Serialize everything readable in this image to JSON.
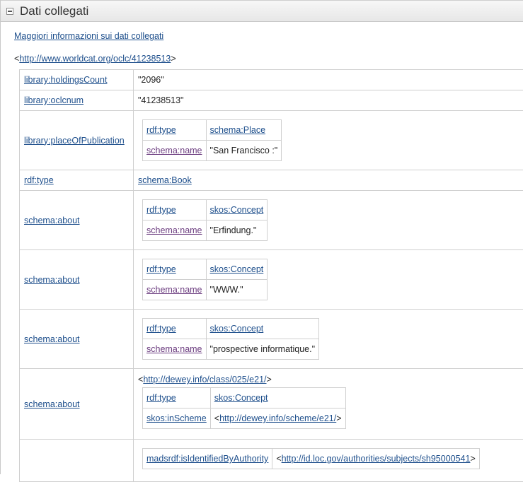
{
  "panel": {
    "title": "Dati collegati"
  },
  "more_link": "Maggiori informazioni sui dati collegati",
  "subject": {
    "open": "<",
    "uri": "http://www.worldcat.org/oclc/41238513",
    "close": ">"
  },
  "rows": [
    {
      "key": "library:holdingsCount",
      "value": "\"2096\""
    },
    {
      "key": "library:oclcnum",
      "value": "\"41238513\""
    },
    {
      "key": "library:placeOfPublication",
      "nested": [
        [
          "rdf:type",
          "schema:Place"
        ],
        [
          "schema:name",
          "\"San Francisco :\""
        ]
      ]
    },
    {
      "key": "rdf:type",
      "value": "schema:Book"
    },
    {
      "key": "schema:about",
      "nested": [
        [
          "rdf:type",
          "skos:Concept"
        ],
        [
          "schema:name",
          "\"Erfindung.\""
        ]
      ]
    },
    {
      "key": "schema:about",
      "nested": [
        [
          "rdf:type",
          "skos:Concept"
        ],
        [
          "schema:name",
          "\"WWW.\""
        ]
      ]
    },
    {
      "key": "schema:about",
      "nested": [
        [
          "rdf:type",
          "skos:Concept"
        ],
        [
          "schema:name",
          "\"prospective informatique.\""
        ]
      ]
    },
    {
      "key": "schema:about",
      "uri": "http://dewey.info/class/025/e21/",
      "nested": [
        [
          "rdf:type",
          "skos:Concept"
        ],
        [
          "skos:inScheme",
          "http://dewey.info/scheme/e21/"
        ]
      ]
    },
    {
      "key": "",
      "nested": [
        [
          "madsrdf:isIdentifiedByAuthority",
          "http://id.loc.gov/authorities/subjects/sh95000541"
        ]
      ]
    }
  ]
}
